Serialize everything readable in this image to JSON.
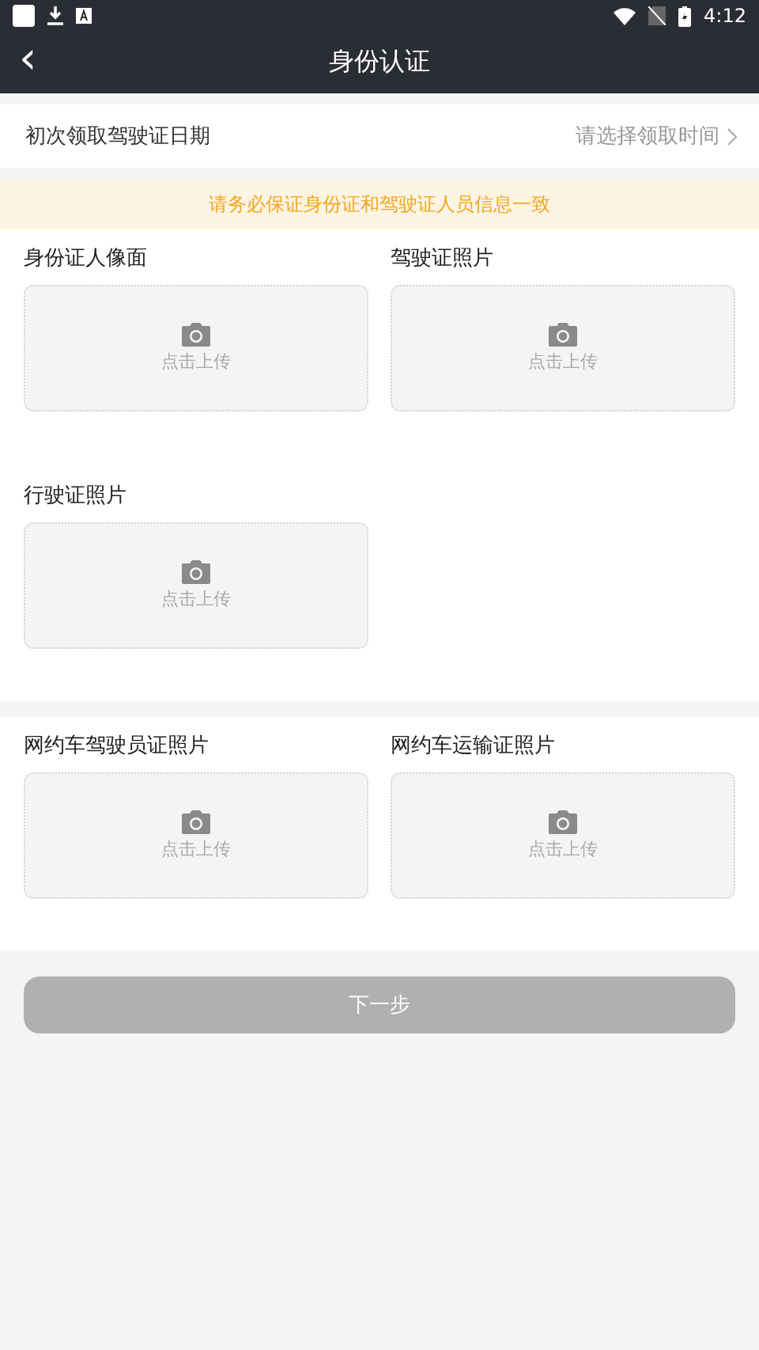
{
  "status_bar": {
    "time": "4:12"
  },
  "nav": {
    "title": "身份认证",
    "back_icon": "‹"
  },
  "date_row": {
    "label": "初次领取驾驶证日期",
    "placeholder": "请选择领取时间"
  },
  "notice": "请务必保证身份证和驾驶证人员信息一致",
  "sections": [
    {
      "uploads": [
        {
          "label": "身份证人像面",
          "hint": "点击上传"
        },
        {
          "label": "驾驶证照片",
          "hint": "点击上传"
        },
        {
          "label": "行驶证照片",
          "hint": "点击上传"
        }
      ]
    },
    {
      "uploads": [
        {
          "label": "网约车驾驶员证照片",
          "hint": "点击上传"
        },
        {
          "label": "网约车运输证照片",
          "hint": "点击上传"
        }
      ]
    }
  ],
  "next_button": {
    "label": "下一步",
    "disabled": true
  }
}
